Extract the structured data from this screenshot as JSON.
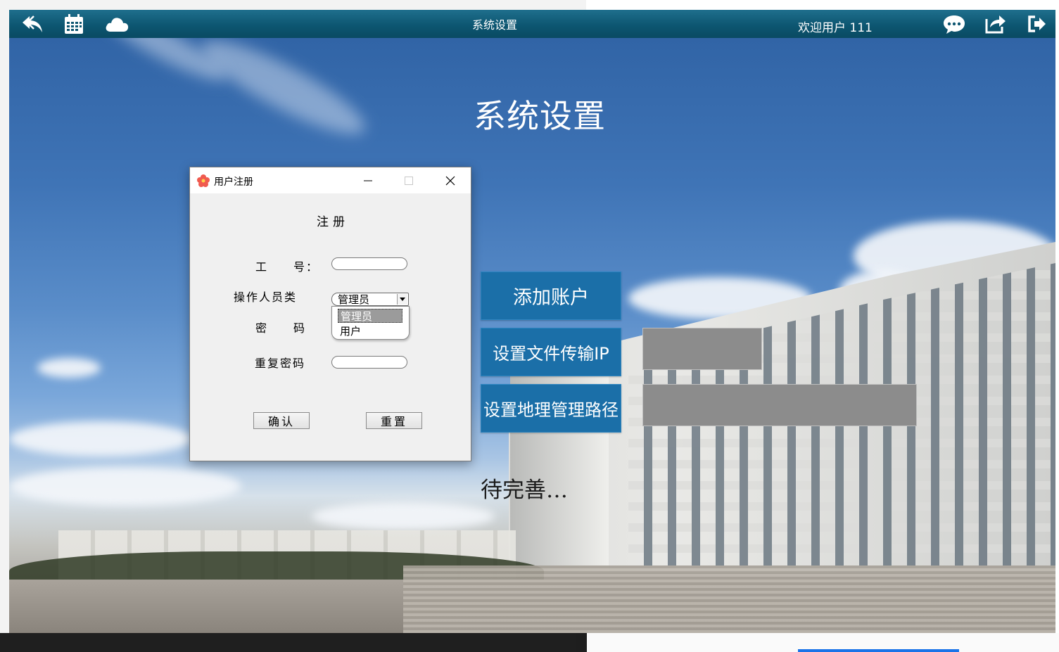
{
  "app": {
    "topbar_title": "系统设置",
    "welcome_text": "欢迎用户 111",
    "page_title": "系统设置",
    "icons": [
      "back-reply-icon",
      "calendar-icon",
      "cloud-icon",
      "chat-icon",
      "share-icon",
      "logout-icon"
    ]
  },
  "settings": {
    "add_account_label": "添加账户",
    "set_ip_label": "设置文件传输IP",
    "set_path_label": "设置地理管理路径",
    "ip_value": "",
    "path_value": "",
    "pending_text": "待完善…"
  },
  "dialog": {
    "title": "用户注册",
    "heading": "注册",
    "employee_id_label": "工　　号：",
    "employee_id_value": "",
    "operator_type_label": "操作人员类",
    "operator_type_selected": "管理员",
    "operator_type_options": [
      "管理员",
      "用户"
    ],
    "password_label": "密　　码",
    "password_value": "",
    "repeat_password_label": "重复密码",
    "repeat_password_value": "",
    "confirm_label": "确认",
    "reset_label": "重置"
  },
  "colors": {
    "topbar": "#0d5671",
    "side_button": "#1b6fa8",
    "gray_field": "#8c8c8c",
    "dialog_bg": "#f0f0f0"
  }
}
